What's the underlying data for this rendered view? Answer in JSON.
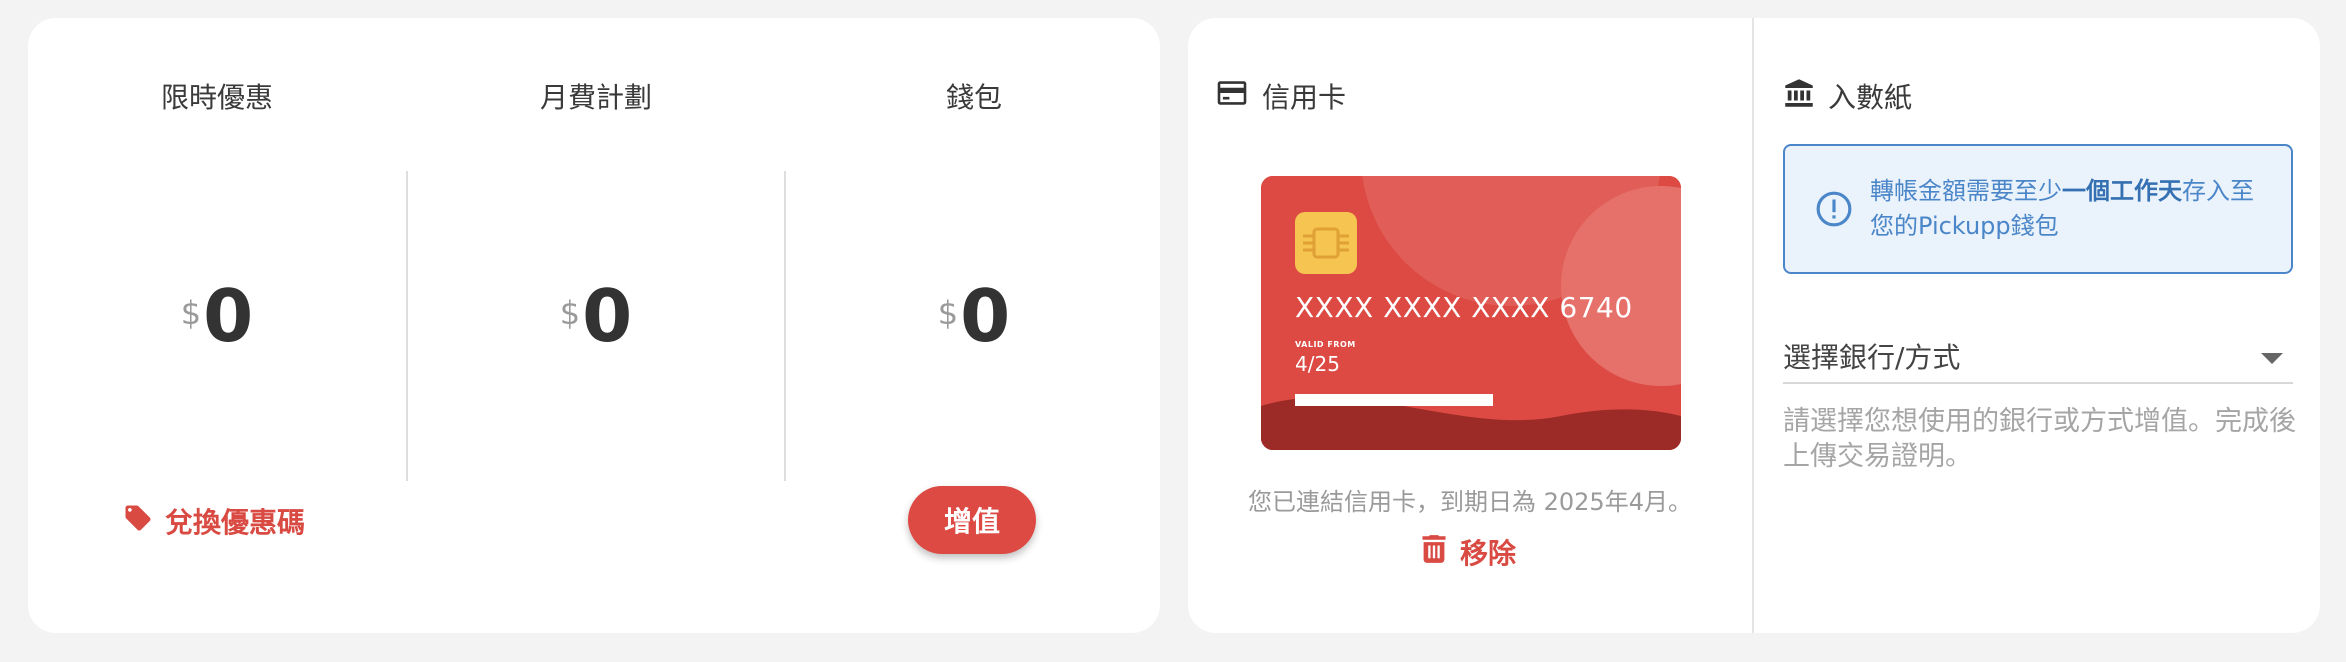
{
  "balances": [
    {
      "title": "限時優惠",
      "currency": "$",
      "value": "0"
    },
    {
      "title": "月費計劃",
      "currency": "$",
      "value": "0"
    },
    {
      "title": "錢包",
      "currency": "$",
      "value": "0"
    }
  ],
  "actions": {
    "promo_label": "兌換優惠碼",
    "topup_label": "增值"
  },
  "credit_card": {
    "heading": "信用卡",
    "number": "XXXX XXXX XXXX 6740",
    "valid_from_label": "VALID FROM",
    "valid_date": "4/25",
    "note": "您已連結信用卡，到期日為 2025年4月。",
    "remove_label": "移除"
  },
  "transfer": {
    "heading": "入數紙",
    "notice_pre": "轉帳金額需要至少",
    "notice_bold": "一個工作天",
    "notice_post": "存入至您的Pickupp錢包",
    "select_label": "選擇銀行/方式",
    "help_text": "請選擇您想使用的銀行或方式增值。完成後上傳交易證明。"
  },
  "colors": {
    "accent_red": "#dd4a43",
    "info_blue": "#4a86c8",
    "chip_gold": "#f5c451"
  },
  "icons": [
    "tag-icon",
    "credit-card-icon",
    "bank-icon",
    "info-icon",
    "trash-icon",
    "chevron-down-icon"
  ]
}
